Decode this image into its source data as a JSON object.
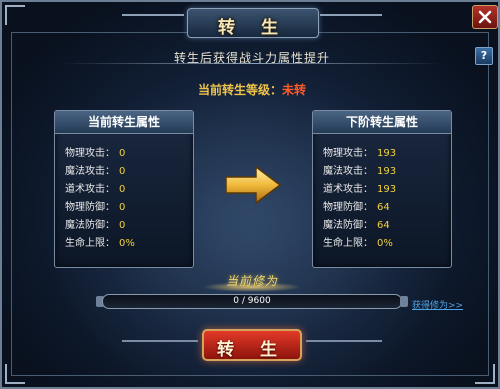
{
  "window": {
    "title": "转 生"
  },
  "subtitle": "转生后获得战斗力属性提升",
  "current_level": {
    "label": "当前转生等级：",
    "value": "未转"
  },
  "current_panel": {
    "title": "当前转生属性",
    "rows": [
      {
        "label": "物理攻击：",
        "value": "0"
      },
      {
        "label": "魔法攻击：",
        "value": "0"
      },
      {
        "label": "道术攻击：",
        "value": "0"
      },
      {
        "label": "物理防御：",
        "value": "0"
      },
      {
        "label": "魔法防御：",
        "value": "0"
      },
      {
        "label": "生命上限：",
        "value": "0%"
      }
    ]
  },
  "next_panel": {
    "title": "下阶转生属性",
    "rows": [
      {
        "label": "物理攻击：",
        "value": "193"
      },
      {
        "label": "魔法攻击：",
        "value": "193"
      },
      {
        "label": "道术攻击：",
        "value": "193"
      },
      {
        "label": "物理防御：",
        "value": "64"
      },
      {
        "label": "魔法防御：",
        "value": "64"
      },
      {
        "label": "生命上限：",
        "value": "0%"
      }
    ]
  },
  "progress": {
    "label": "当前修为",
    "text": "0 / 9600",
    "fraction": 0
  },
  "link_text": "获得修为>>",
  "action_button": "转 生",
  "colors": {
    "accent_gold": "#f2d23a",
    "button_red": "#e33a28",
    "level_red": "#ff5a2a"
  },
  "icons": {
    "close": "close-icon",
    "help": "help-icon",
    "arrow": "arrow-right-icon"
  }
}
